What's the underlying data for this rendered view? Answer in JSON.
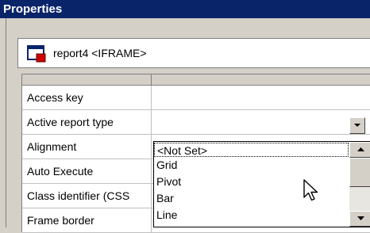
{
  "window": {
    "title": "Properties"
  },
  "object_selector": {
    "icon": "report-iframe-icon",
    "value": "report4 <IFRAME>"
  },
  "properties": [
    {
      "name": "Access key"
    },
    {
      "name": "Active report type"
    },
    {
      "name": "Alignment"
    },
    {
      "name": "Auto Execute"
    },
    {
      "name": "Class identifier (CSS"
    },
    {
      "name": "Frame border"
    }
  ],
  "dropdown": {
    "options": [
      "<Not Set>",
      "Grid",
      "Pivot",
      "Bar",
      "Line"
    ],
    "highlighted": "<Not Set>"
  },
  "icons": {
    "dropdown_arrow": "chevron-down-icon",
    "scroll_up": "scroll-up-icon",
    "scroll_down": "scroll-down-icon",
    "cursor": "mouse-pointer-icon"
  },
  "colors": {
    "titlebar": "#0a246a",
    "face": "#d4d0c8"
  }
}
